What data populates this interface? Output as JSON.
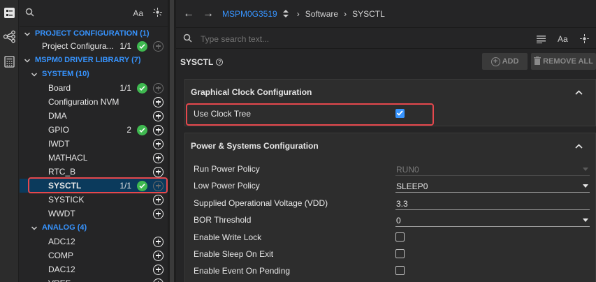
{
  "sidebar": {
    "search_placeholder": "",
    "aa_label": "Aa",
    "tree": [
      {
        "kind": "cat",
        "label": "PROJECT CONFIGURATION (1)"
      },
      {
        "kind": "item",
        "label": "Project Configura...",
        "count": "1/1",
        "ok": true,
        "add_dim": true
      },
      {
        "kind": "cat",
        "label": "MSPM0 DRIVER LIBRARY (7)"
      },
      {
        "kind": "subcat",
        "label": "SYSTEM (10)"
      },
      {
        "kind": "item",
        "label": "Board",
        "count": "1/1",
        "ok": true,
        "add_dim": true
      },
      {
        "kind": "item",
        "label": "Configuration NVM"
      },
      {
        "kind": "item",
        "label": "DMA"
      },
      {
        "kind": "item",
        "label": "GPIO",
        "count": "2",
        "ok": true
      },
      {
        "kind": "item",
        "label": "IWDT"
      },
      {
        "kind": "item",
        "label": "MATHACL"
      },
      {
        "kind": "item",
        "label": "RTC_B"
      },
      {
        "kind": "item",
        "label": "SYSCTL",
        "count": "1/1",
        "ok": true,
        "add_dim": true,
        "selected": true
      },
      {
        "kind": "item",
        "label": "SYSTICK"
      },
      {
        "kind": "item",
        "label": "WWDT"
      },
      {
        "kind": "subcat",
        "label": "ANALOG (4)"
      },
      {
        "kind": "item",
        "label": "ADC12"
      },
      {
        "kind": "item",
        "label": "COMP"
      },
      {
        "kind": "item",
        "label": "DAC12"
      },
      {
        "kind": "item",
        "label": "VREF"
      }
    ]
  },
  "header": {
    "device": "MSPM0G3519",
    "crumb_software": "Software",
    "crumb_sysctl": "SYSCTL"
  },
  "search": {
    "placeholder": "Type search text...",
    "aa_label": "Aa"
  },
  "module": {
    "title": "SYSCTL",
    "add_label": "ADD",
    "remove_all_label": "REMOVE ALL"
  },
  "clock_panel": {
    "title": "Graphical Clock Configuration",
    "use_clock_tree_label": "Use Clock Tree",
    "use_clock_tree_checked": true
  },
  "power_panel": {
    "title": "Power & Systems Configuration",
    "fields": [
      {
        "label": "Run Power Policy",
        "value": "RUN0",
        "type": "select",
        "disabled": true
      },
      {
        "label": "Low Power Policy",
        "value": "SLEEP0",
        "type": "select"
      },
      {
        "label": "Supplied Operational Voltage (VDD)",
        "value": "3.3",
        "type": "text"
      },
      {
        "label": "BOR Threshold",
        "value": "0",
        "type": "select"
      },
      {
        "label": "Enable Write Lock",
        "type": "checkbox",
        "checked": false
      },
      {
        "label": "Enable Sleep On Exit",
        "type": "checkbox",
        "checked": false
      },
      {
        "label": "Enable Event On Pending",
        "type": "checkbox",
        "checked": false
      }
    ]
  },
  "colors": {
    "accent": "#3794ff",
    "ok": "#3fb950",
    "highlight": "#e5484d"
  }
}
